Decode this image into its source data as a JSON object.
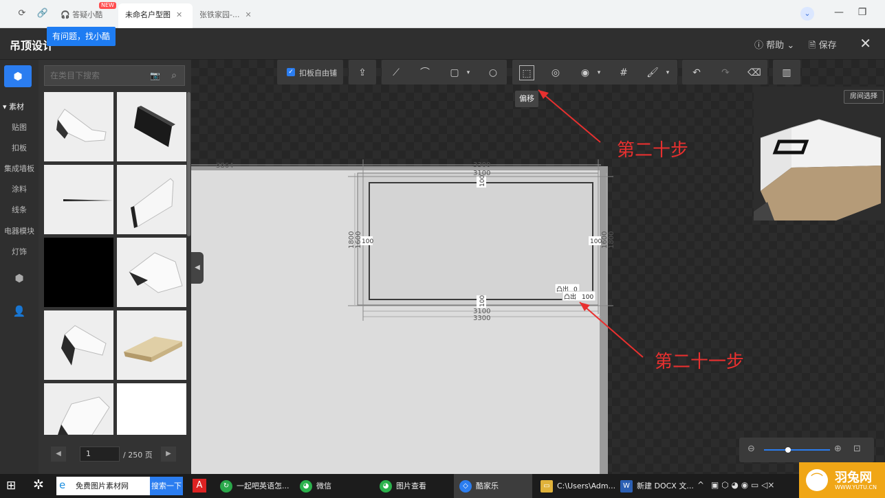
{
  "browser": {
    "tabs": [
      {
        "label": "答疑小酷",
        "badge": "NEW"
      },
      {
        "label": "未命名户型图"
      },
      {
        "label": "张铁家园-..."
      }
    ],
    "tooltip": "有问题，找小酷"
  },
  "app": {
    "title": "吊顶设计",
    "help_label": "帮助",
    "save_label": "保存"
  },
  "rail": {
    "section": "▾ 素材",
    "items": [
      "贴图",
      "扣板",
      "集成墙板",
      "涂料",
      "线条",
      "电器模块",
      "灯饰"
    ]
  },
  "panel": {
    "search_placeholder": "在类目下搜索",
    "page_current": "1",
    "page_total": "/ 250 页"
  },
  "toolbar": {
    "checkbox_label": "扣板自由铺",
    "tooltip": "偏移"
  },
  "drawing": {
    "dims": {
      "d_3864": "3864",
      "d_3300_top": "3300",
      "d_3100_top": "3100",
      "d_100_top": "100",
      "d_1800": "1800",
      "d_1600": "1600",
      "d_100_left": "100",
      "d_100_right": "100",
      "d_1600_right": "1600",
      "d_1800_right": "1800",
      "d_100_bottom": "100",
      "d_3100_bottom": "3100",
      "d_3300_bottom": "3300"
    },
    "prop1_label": "凸出",
    "prop1_value": "0",
    "prop2_label": "凸出",
    "prop2_value": "100"
  },
  "preview": {
    "room_select": "房间选择"
  },
  "annotations": {
    "step20": "第二十步",
    "step21": "第二十一步"
  },
  "taskbar": {
    "search_text": "免费图片素材网",
    "search_button": "搜索一下",
    "items": [
      {
        "label": "一起吧英语怎..."
      },
      {
        "label": "微信"
      },
      {
        "label": "图片查看"
      },
      {
        "label": "酷家乐"
      },
      {
        "label": "C:\\Users\\Adm..."
      },
      {
        "label": "新建 DOCX 文..."
      }
    ]
  },
  "watermark": {
    "brand": "羽兔网",
    "url": "WWW.YUTU.CN"
  },
  "colors": {
    "accent": "#2b7df0",
    "annotation": "#e8302f",
    "watermark_bg": "#f0a616"
  }
}
